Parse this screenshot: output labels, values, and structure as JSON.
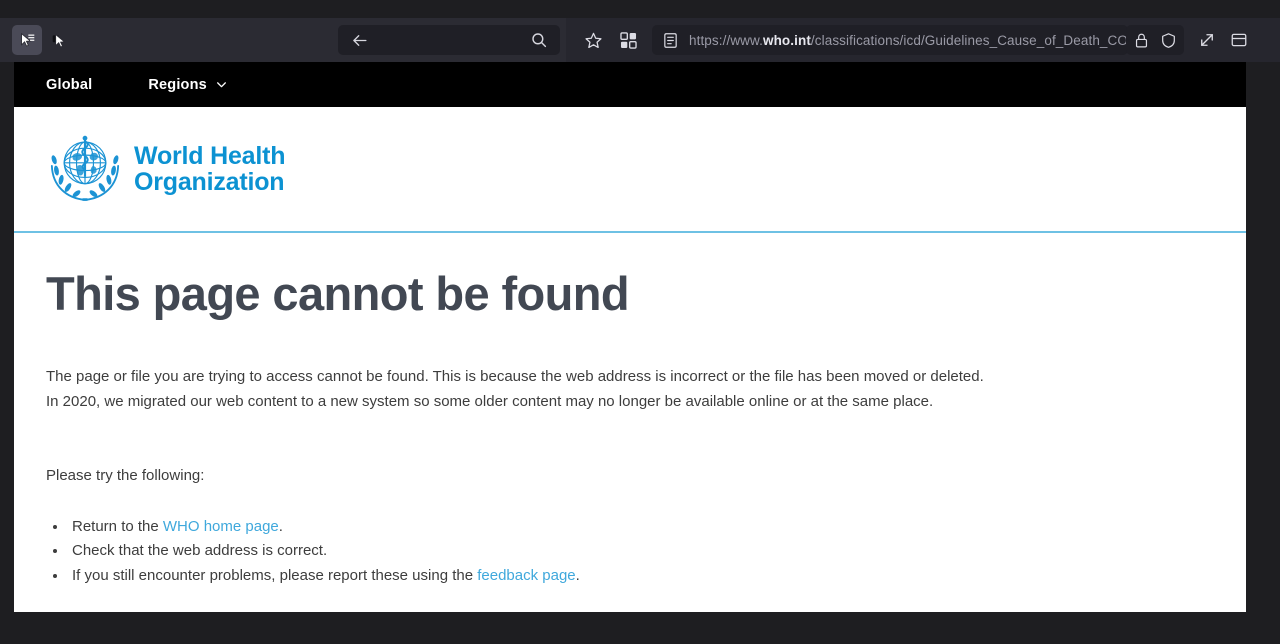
{
  "browser": {
    "cursor_tools": [
      {
        "name": "cursor-select-tool",
        "active": true
      },
      {
        "name": "cursor-inspect-tool",
        "active": false
      }
    ],
    "search": {
      "back_icon": "arrow-left-icon",
      "search_icon": "search-icon",
      "value": "",
      "placeholder": ""
    },
    "toolbar_icons": [
      "bookmark-star-icon",
      "extensions-puzzle-icon",
      "copy-pages-icon"
    ],
    "address": {
      "reader_icon": "reader-view-icon",
      "url_prefix": "https://www.",
      "url_domain": "who.int",
      "url_path": "/classifications/icd/Guidelines_Cause_of_Death_COVID"
    },
    "right_icons": [
      "lock-icon",
      "shield-icon",
      "expand-arrows-icon",
      "split-window-icon"
    ]
  },
  "site": {
    "nav": [
      {
        "label": "Global",
        "has_chevron": false
      },
      {
        "label": "Regions",
        "has_chevron": true
      }
    ],
    "logo": {
      "name": "who-emblem-icon",
      "line1": "World Health",
      "line2": "Organization",
      "color": "#0c92d2"
    },
    "divider_color": "#6ec1e4"
  },
  "page": {
    "title": "This page cannot be found",
    "intro_line1": "The page or file you are trying to access cannot be found. This is because the web address is incorrect or the file has been moved or deleted.",
    "intro_line2": "In 2020, we migrated our web content to a new system so some older content may no longer be available online or at the same place.",
    "try_following": "Please try the following:",
    "tips": [
      {
        "before": "Return to the ",
        "link": "WHO home page",
        "after": "."
      },
      {
        "before": "Check that the web address is correct.",
        "link": "",
        "after": ""
      },
      {
        "before": "If you still encounter problems, please report these using the ",
        "link": "feedback page",
        "after": "."
      }
    ],
    "link_color": "#3fa8dc",
    "heading_color": "#424853"
  }
}
